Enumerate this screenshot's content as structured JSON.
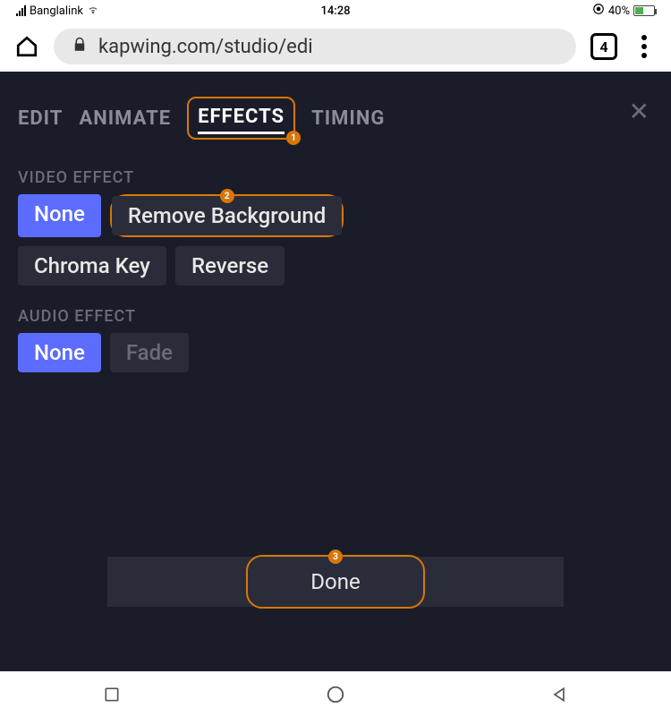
{
  "status_bar": {
    "carrier": "Banglalink",
    "time": "14:28",
    "battery_pct": "40%"
  },
  "browser": {
    "url": "kapwing.com/studio/edi",
    "tab_count": "4"
  },
  "tabs": {
    "edit": "EDIT",
    "animate": "ANIMATE",
    "effects": "EFFECTS",
    "timing": "TIMING"
  },
  "sections": {
    "video_label": "VIDEO EFFECT",
    "audio_label": "AUDIO EFFECT"
  },
  "video_effects": {
    "none": "None",
    "remove_bg": "Remove Background",
    "chroma": "Chroma Key",
    "reverse": "Reverse"
  },
  "audio_effects": {
    "none": "None",
    "fade": "Fade"
  },
  "done_label": "Done",
  "annotations": {
    "b1": "1",
    "b2": "2",
    "b3": "3"
  }
}
